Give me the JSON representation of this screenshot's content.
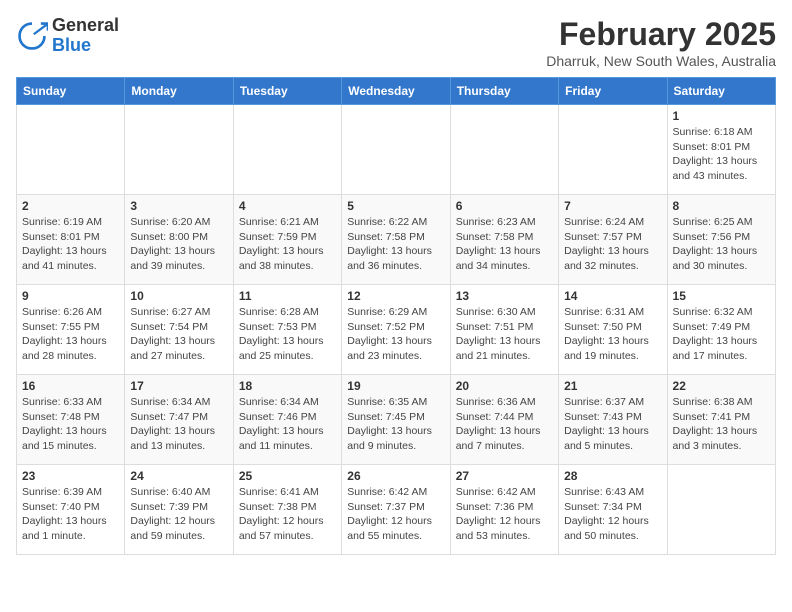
{
  "header": {
    "logo_general": "General",
    "logo_blue": "Blue",
    "month_year": "February 2025",
    "location": "Dharruk, New South Wales, Australia"
  },
  "days_of_week": [
    "Sunday",
    "Monday",
    "Tuesday",
    "Wednesday",
    "Thursday",
    "Friday",
    "Saturday"
  ],
  "weeks": [
    [
      {
        "day": "",
        "info": ""
      },
      {
        "day": "",
        "info": ""
      },
      {
        "day": "",
        "info": ""
      },
      {
        "day": "",
        "info": ""
      },
      {
        "day": "",
        "info": ""
      },
      {
        "day": "",
        "info": ""
      },
      {
        "day": "1",
        "info": "Sunrise: 6:18 AM\nSunset: 8:01 PM\nDaylight: 13 hours and 43 minutes."
      }
    ],
    [
      {
        "day": "2",
        "info": "Sunrise: 6:19 AM\nSunset: 8:01 PM\nDaylight: 13 hours and 41 minutes."
      },
      {
        "day": "3",
        "info": "Sunrise: 6:20 AM\nSunset: 8:00 PM\nDaylight: 13 hours and 39 minutes."
      },
      {
        "day": "4",
        "info": "Sunrise: 6:21 AM\nSunset: 7:59 PM\nDaylight: 13 hours and 38 minutes."
      },
      {
        "day": "5",
        "info": "Sunrise: 6:22 AM\nSunset: 7:58 PM\nDaylight: 13 hours and 36 minutes."
      },
      {
        "day": "6",
        "info": "Sunrise: 6:23 AM\nSunset: 7:58 PM\nDaylight: 13 hours and 34 minutes."
      },
      {
        "day": "7",
        "info": "Sunrise: 6:24 AM\nSunset: 7:57 PM\nDaylight: 13 hours and 32 minutes."
      },
      {
        "day": "8",
        "info": "Sunrise: 6:25 AM\nSunset: 7:56 PM\nDaylight: 13 hours and 30 minutes."
      }
    ],
    [
      {
        "day": "9",
        "info": "Sunrise: 6:26 AM\nSunset: 7:55 PM\nDaylight: 13 hours and 28 minutes."
      },
      {
        "day": "10",
        "info": "Sunrise: 6:27 AM\nSunset: 7:54 PM\nDaylight: 13 hours and 27 minutes."
      },
      {
        "day": "11",
        "info": "Sunrise: 6:28 AM\nSunset: 7:53 PM\nDaylight: 13 hours and 25 minutes."
      },
      {
        "day": "12",
        "info": "Sunrise: 6:29 AM\nSunset: 7:52 PM\nDaylight: 13 hours and 23 minutes."
      },
      {
        "day": "13",
        "info": "Sunrise: 6:30 AM\nSunset: 7:51 PM\nDaylight: 13 hours and 21 minutes."
      },
      {
        "day": "14",
        "info": "Sunrise: 6:31 AM\nSunset: 7:50 PM\nDaylight: 13 hours and 19 minutes."
      },
      {
        "day": "15",
        "info": "Sunrise: 6:32 AM\nSunset: 7:49 PM\nDaylight: 13 hours and 17 minutes."
      }
    ],
    [
      {
        "day": "16",
        "info": "Sunrise: 6:33 AM\nSunset: 7:48 PM\nDaylight: 13 hours and 15 minutes."
      },
      {
        "day": "17",
        "info": "Sunrise: 6:34 AM\nSunset: 7:47 PM\nDaylight: 13 hours and 13 minutes."
      },
      {
        "day": "18",
        "info": "Sunrise: 6:34 AM\nSunset: 7:46 PM\nDaylight: 13 hours and 11 minutes."
      },
      {
        "day": "19",
        "info": "Sunrise: 6:35 AM\nSunset: 7:45 PM\nDaylight: 13 hours and 9 minutes."
      },
      {
        "day": "20",
        "info": "Sunrise: 6:36 AM\nSunset: 7:44 PM\nDaylight: 13 hours and 7 minutes."
      },
      {
        "day": "21",
        "info": "Sunrise: 6:37 AM\nSunset: 7:43 PM\nDaylight: 13 hours and 5 minutes."
      },
      {
        "day": "22",
        "info": "Sunrise: 6:38 AM\nSunset: 7:41 PM\nDaylight: 13 hours and 3 minutes."
      }
    ],
    [
      {
        "day": "23",
        "info": "Sunrise: 6:39 AM\nSunset: 7:40 PM\nDaylight: 13 hours and 1 minute."
      },
      {
        "day": "24",
        "info": "Sunrise: 6:40 AM\nSunset: 7:39 PM\nDaylight: 12 hours and 59 minutes."
      },
      {
        "day": "25",
        "info": "Sunrise: 6:41 AM\nSunset: 7:38 PM\nDaylight: 12 hours and 57 minutes."
      },
      {
        "day": "26",
        "info": "Sunrise: 6:42 AM\nSunset: 7:37 PM\nDaylight: 12 hours and 55 minutes."
      },
      {
        "day": "27",
        "info": "Sunrise: 6:42 AM\nSunset: 7:36 PM\nDaylight: 12 hours and 53 minutes."
      },
      {
        "day": "28",
        "info": "Sunrise: 6:43 AM\nSunset: 7:34 PM\nDaylight: 12 hours and 50 minutes."
      },
      {
        "day": "",
        "info": ""
      }
    ]
  ]
}
